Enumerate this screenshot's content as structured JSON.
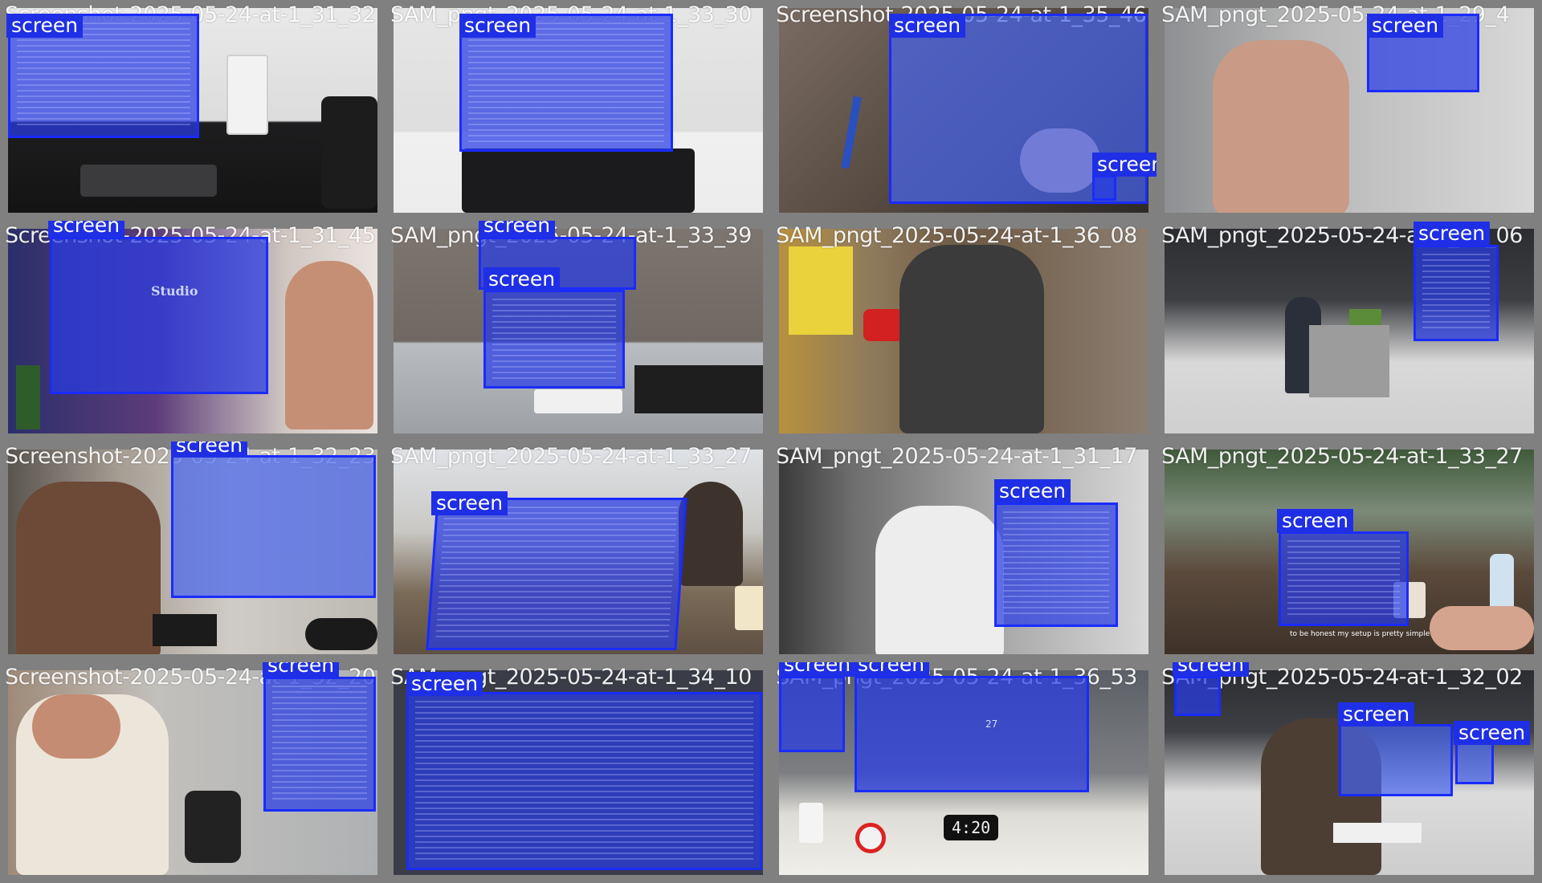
{
  "tiles": [
    {
      "title": "Screenshot-2025-05-24-at-1_31_32"
    },
    {
      "title": "SAM_pngt_2025-05-24-at-1_33_30"
    },
    {
      "title": "Screenshot-2025-05-24-at-1_35_46"
    },
    {
      "title": "SAM_pngt_2025-05-24-at-1_29_4"
    },
    {
      "title": "Screenshot-2025-05-24-at-1_31_45"
    },
    {
      "title": "SAM_pngt_2025-05-24-at-1_33_39"
    },
    {
      "title": "SAM_pngt_2025-05-24-at-1_36_08"
    },
    {
      "title": "SAM_pngt_2025-05-24-at-1_34_06"
    },
    {
      "title": "Screenshot-2025-05-24-at-1_32_23"
    },
    {
      "title": "SAM_pngt_2025-05-24-at-1_33_27"
    },
    {
      "title": "SAM_pngt_2025-05-24-at-1_31_17"
    },
    {
      "title": "SAM_pngt_2025-05-24-at-1_33_27"
    },
    {
      "title": "Screenshot-2025-05-24-at-1_32_20"
    },
    {
      "title": "SAM_pngt_2025-05-24-at-1_34_10"
    },
    {
      "title": "SAM_pngt_2025-05-24-at-1_36_53"
    },
    {
      "title": "SAM_pngt_2025-05-24-at-1_32_02"
    }
  ],
  "detection_label": "screen",
  "overlay_color": "#1a2bff",
  "scene_text": {
    "studio": "Studio",
    "caption": "to be honest my setup is pretty simple",
    "clock": "4:20",
    "screen_number": "27"
  }
}
